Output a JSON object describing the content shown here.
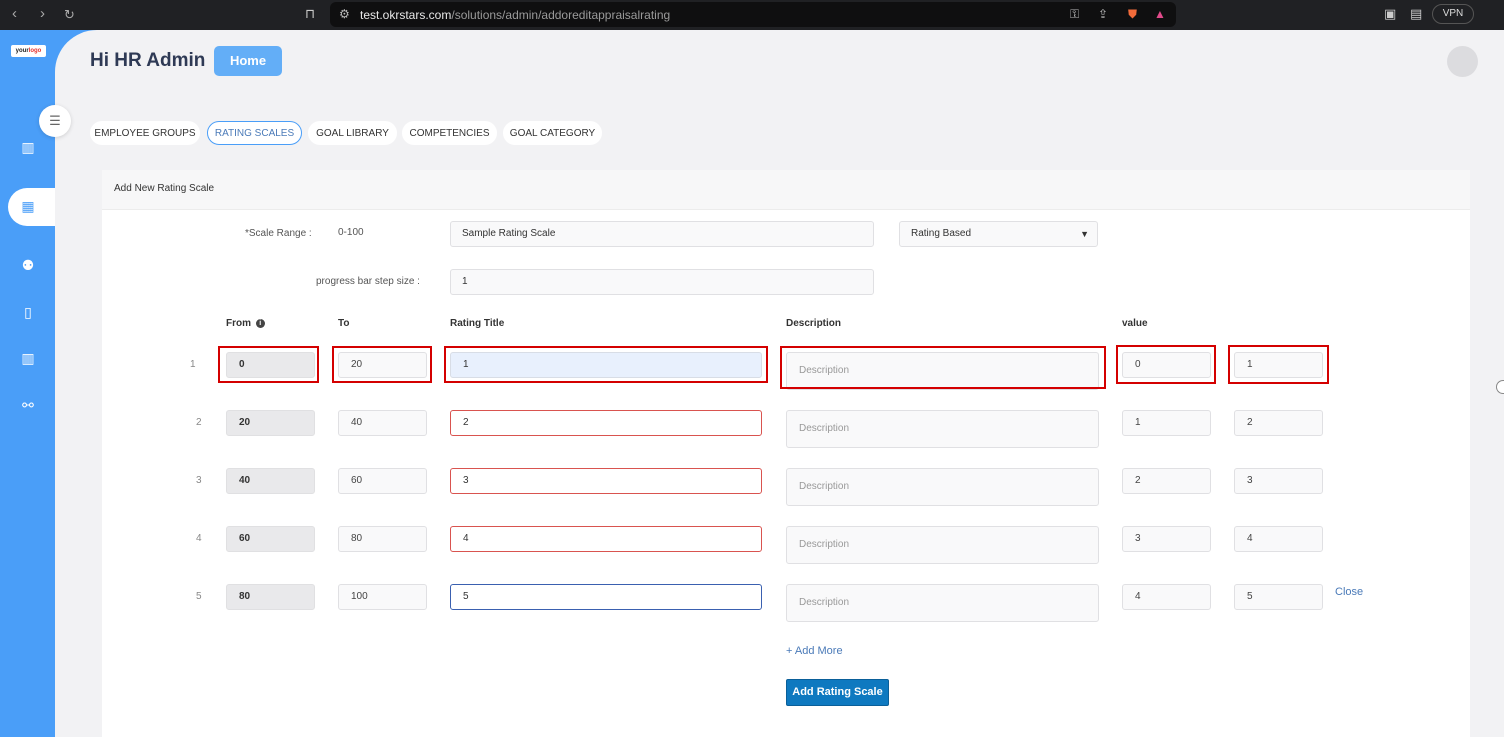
{
  "browser": {
    "url_host": "test.okrstars.com",
    "url_path": "/solutions/admin/addoreditappraisalrating",
    "vpn_label": "VPN"
  },
  "sidebar": {
    "logo_text_a": "your",
    "logo_text_b": "logo",
    "icons": [
      "bar-chart-icon",
      "grid-icon",
      "users-icon",
      "book-icon",
      "chart-icon",
      "handshake-icon"
    ]
  },
  "header": {
    "greeting": "Hi HR Admin",
    "home_label": "Home"
  },
  "tabs": [
    {
      "label": "EMPLOYEE GROUPS"
    },
    {
      "label": "RATING SCALES"
    },
    {
      "label": "GOAL LIBRARY"
    },
    {
      "label": "COMPETENCIES"
    },
    {
      "label": "GOAL CATEGORY"
    }
  ],
  "card": {
    "title": "Add New Rating Scale"
  },
  "form": {
    "scale_range_label": "*Scale Range :",
    "scale_range_value": "0-100",
    "scale_name": "Sample Rating Scale",
    "scale_type": "Rating Based",
    "step_label": "progress bar step size :",
    "step_value": "1"
  },
  "columns": {
    "from": "From",
    "to": "To",
    "rating_title": "Rating Title",
    "description": "Description",
    "value": "value"
  },
  "rows": [
    {
      "num": "1",
      "from": "0",
      "to": "20",
      "title": "1",
      "description_placeholder": "Description",
      "value_a": "0",
      "value_b": "1"
    },
    {
      "num": "2",
      "from": "20",
      "to": "40",
      "title": "2",
      "description_placeholder": "Description",
      "value_a": "1",
      "value_b": "2"
    },
    {
      "num": "3",
      "from": "40",
      "to": "60",
      "title": "3",
      "description_placeholder": "Description",
      "value_a": "2",
      "value_b": "3"
    },
    {
      "num": "4",
      "from": "60",
      "to": "80",
      "title": "4",
      "description_placeholder": "Description",
      "value_a": "3",
      "value_b": "4"
    },
    {
      "num": "5",
      "from": "80",
      "to": "100",
      "title": "5",
      "description_placeholder": "Description",
      "value_a": "4",
      "value_b": "5"
    }
  ],
  "actions": {
    "close_label": "Close",
    "add_more_label": "+ Add More",
    "add_scale_label": "Add Rating Scale"
  }
}
